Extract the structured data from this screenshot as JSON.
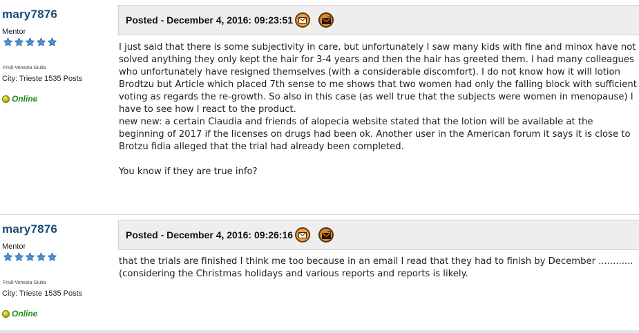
{
  "posts": [
    {
      "author": "mary7876",
      "rank": "Mentor",
      "region": "Friuli-Venezia Giulia",
      "city_posts": "City: Trieste 1535 Posts",
      "status": "Online",
      "posted": "Posted - December 4, 2016:  09:23:51",
      "body": "I just said that there is some subjectivity in care, but unfortunately I saw many kids with fine and minox have not solved anything they only kept the hair for 3-4 years and then the hair has greeted them. I had many colleagues who unfortunately have resigned themselves (with a considerable discomfort). I do not know how it will lotion Brodtzu but Article which placed 7th sense to me shows that two women had only the falling block with sufficient voting as regards the re-growth. So also in this case (as well true that the subjects were women in menopause) I have to see how I react to the product.\nnew new: a certain Claudia and friends of alopecia website stated that the lotion will be available at the beginning of 2017 if the licenses on drugs had been ok. Another user in the American forum it says it is close to Brotzu fidia alleged that the trial had already been completed.\n\nYou know if they are true info?"
    },
    {
      "author": "mary7876",
      "rank": "Mentor",
      "region": "Friuli-Venezia Giulia",
      "city_posts": "City: Trieste 1535 Posts",
      "status": "Online",
      "posted": "Posted - December 4, 2016:  09:26:16",
      "body": "that the trials are finished I think me too because in an email I read that they had to finish by December ............ (considering the Christmas holidays and various reports and reports is likely."
    }
  ],
  "icons": {
    "star": "star-icon",
    "email": "email-icon",
    "private_message": "private-message-icon",
    "status": "online-status-icon"
  },
  "colors": {
    "username": "#1a4a7a",
    "online": "#1c8c1c",
    "star": "#4a90d9",
    "header_bg": "#eeeeee"
  }
}
